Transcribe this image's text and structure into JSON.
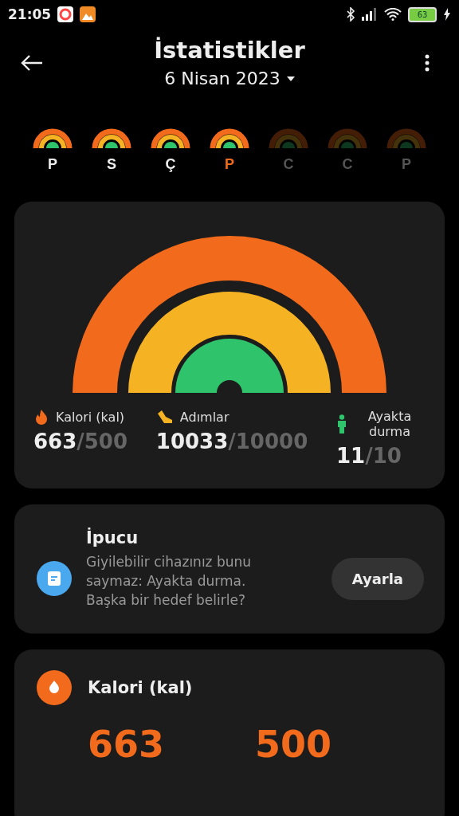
{
  "status_bar": {
    "time": "21:05",
    "battery": "63"
  },
  "header": {
    "title": "İstatistikler",
    "date": "6 Nisan 2023"
  },
  "days": [
    {
      "letter": "P",
      "selected": false,
      "disabled": false
    },
    {
      "letter": "S",
      "selected": false,
      "disabled": false
    },
    {
      "letter": "Ç",
      "selected": false,
      "disabled": false
    },
    {
      "letter": "P",
      "selected": true,
      "disabled": false
    },
    {
      "letter": "C",
      "selected": false,
      "disabled": true
    },
    {
      "letter": "C",
      "selected": false,
      "disabled": true
    },
    {
      "letter": "P",
      "selected": false,
      "disabled": true
    }
  ],
  "summary": {
    "stats": [
      {
        "kind": "calories",
        "label": "Kalori (kal)",
        "value": "663",
        "goal": "/500"
      },
      {
        "kind": "steps",
        "label": "Adımlar",
        "value": "10033",
        "goal": "/10000"
      },
      {
        "kind": "standing",
        "label": "Ayakta durma",
        "value": "11",
        "goal": "/10"
      }
    ]
  },
  "tip": {
    "title": "İpucu",
    "text": "Giyilebilir cihazınız bunu saymaz: Ayakta durma. Başka bir hedef belirle?",
    "button": "Ayarla"
  },
  "calorie_card": {
    "title": "Kalori (kal)",
    "value": "663",
    "goal": "500"
  }
}
